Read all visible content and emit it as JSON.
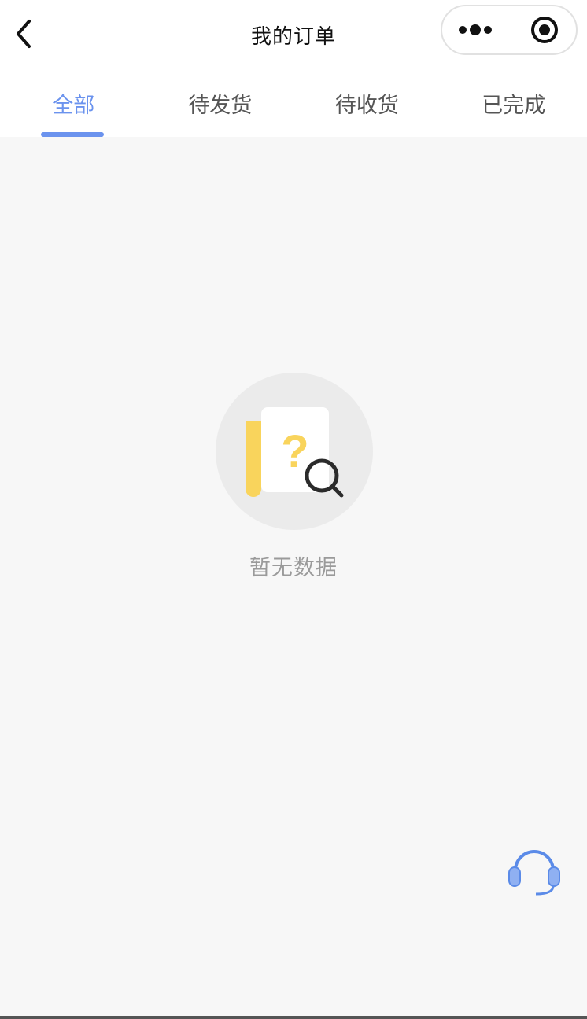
{
  "navbar": {
    "title": "我的订单",
    "back_icon": "chevron-left-icon",
    "more_icon": "more-dots-icon",
    "close_icon": "target-close-icon"
  },
  "tabs": [
    {
      "label": "全部",
      "active": true
    },
    {
      "label": "待发货",
      "active": false
    },
    {
      "label": "待收货",
      "active": false
    },
    {
      "label": "已完成",
      "active": false
    }
  ],
  "empty_state": {
    "icon": "document-search-icon",
    "text": "暂无数据"
  },
  "customer_service": {
    "icon": "headset-icon"
  },
  "colors": {
    "accent": "#6b93ee",
    "background": "#f7f7f7",
    "illustration_yellow": "#f9d45c",
    "muted_text": "#9a9a9a"
  }
}
